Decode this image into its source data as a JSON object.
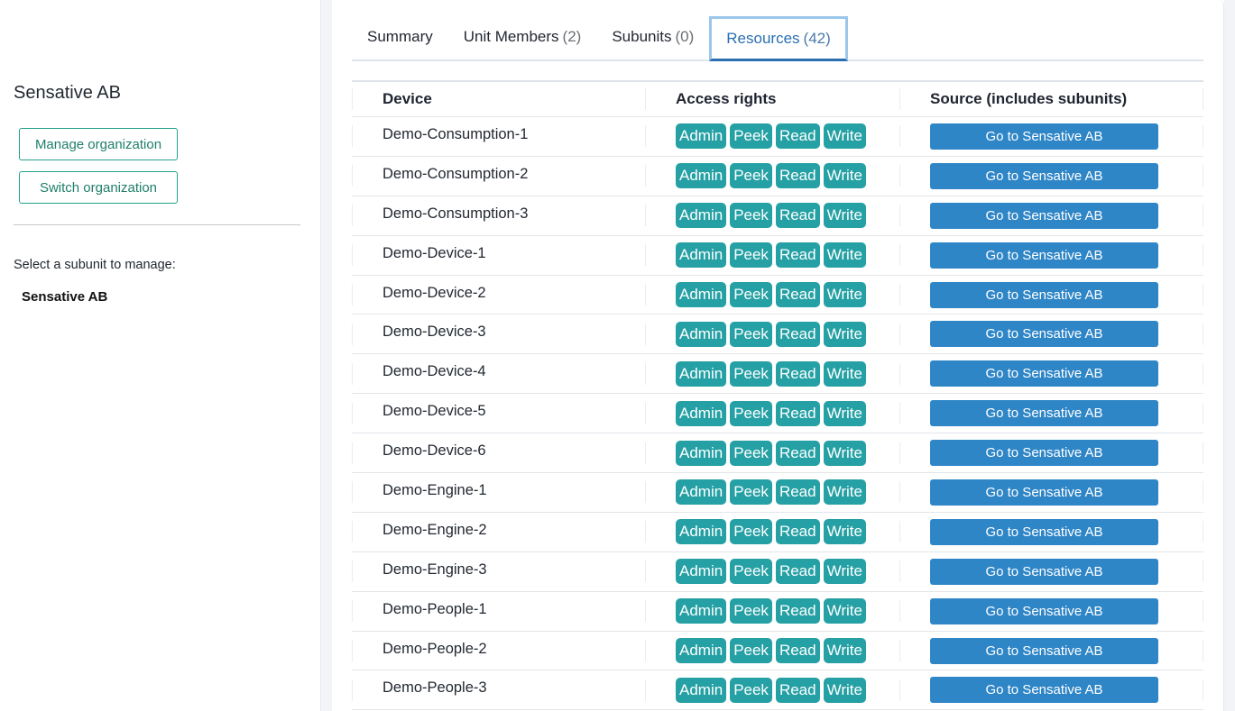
{
  "sidebar": {
    "org_title": "Sensative AB",
    "manage_button": "Manage organization",
    "switch_button": "Switch organization",
    "subunit_prompt": "Select a subunit to manage:",
    "subunits": [
      "Sensative AB"
    ]
  },
  "tabs": [
    {
      "label": "Summary",
      "count": "",
      "active": false
    },
    {
      "label": "Unit Members",
      "count": "(2)",
      "active": false
    },
    {
      "label": "Subunits",
      "count": "(0)",
      "active": false
    },
    {
      "label": "Resources",
      "count": "(42)",
      "active": true
    }
  ],
  "table": {
    "headers": [
      "Device",
      "Access rights",
      "Source (includes subunits)"
    ],
    "rows": [
      {
        "device": "Demo-Consumption-1",
        "rights": [
          "Admin",
          "Peek",
          "Read",
          "Write"
        ],
        "source": "Go to Sensative AB"
      },
      {
        "device": "Demo-Consumption-2",
        "rights": [
          "Admin",
          "Peek",
          "Read",
          "Write"
        ],
        "source": "Go to Sensative AB"
      },
      {
        "device": "Demo-Consumption-3",
        "rights": [
          "Admin",
          "Peek",
          "Read",
          "Write"
        ],
        "source": "Go to Sensative AB"
      },
      {
        "device": "Demo-Device-1",
        "rights": [
          "Admin",
          "Peek",
          "Read",
          "Write"
        ],
        "source": "Go to Sensative AB"
      },
      {
        "device": "Demo-Device-2",
        "rights": [
          "Admin",
          "Peek",
          "Read",
          "Write"
        ],
        "source": "Go to Sensative AB"
      },
      {
        "device": "Demo-Device-3",
        "rights": [
          "Admin",
          "Peek",
          "Read",
          "Write"
        ],
        "source": "Go to Sensative AB"
      },
      {
        "device": "Demo-Device-4",
        "rights": [
          "Admin",
          "Peek",
          "Read",
          "Write"
        ],
        "source": "Go to Sensative AB"
      },
      {
        "device": "Demo-Device-5",
        "rights": [
          "Admin",
          "Peek",
          "Read",
          "Write"
        ],
        "source": "Go to Sensative AB"
      },
      {
        "device": "Demo-Device-6",
        "rights": [
          "Admin",
          "Peek",
          "Read",
          "Write"
        ],
        "source": "Go to Sensative AB"
      },
      {
        "device": "Demo-Engine-1",
        "rights": [
          "Admin",
          "Peek",
          "Read",
          "Write"
        ],
        "source": "Go to Sensative AB"
      },
      {
        "device": "Demo-Engine-2",
        "rights": [
          "Admin",
          "Peek",
          "Read",
          "Write"
        ],
        "source": "Go to Sensative AB"
      },
      {
        "device": "Demo-Engine-3",
        "rights": [
          "Admin",
          "Peek",
          "Read",
          "Write"
        ],
        "source": "Go to Sensative AB"
      },
      {
        "device": "Demo-People-1",
        "rights": [
          "Admin",
          "Peek",
          "Read",
          "Write"
        ],
        "source": "Go to Sensative AB"
      },
      {
        "device": "Demo-People-2",
        "rights": [
          "Admin",
          "Peek",
          "Read",
          "Write"
        ],
        "source": "Go to Sensative AB"
      },
      {
        "device": "Demo-People-3",
        "rights": [
          "Admin",
          "Peek",
          "Read",
          "Write"
        ],
        "source": "Go to Sensative AB"
      }
    ]
  },
  "colors": {
    "accent_teal": "#25a0a4",
    "button_blue": "#2f86c7",
    "outline_green": "#21a08a",
    "active_tab": "#2a6fb0"
  }
}
